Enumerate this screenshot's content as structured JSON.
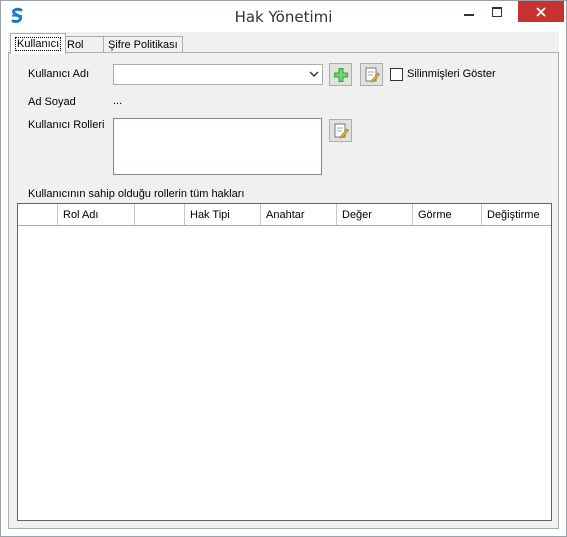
{
  "window": {
    "title": "Hak Yönetimi"
  },
  "tabs": [
    {
      "label": "Kullanıcı",
      "active": true
    },
    {
      "label": "Rol",
      "active": false
    },
    {
      "label": "Şifre Politikası",
      "active": false
    }
  ],
  "user_tab": {
    "username_label": "Kullanıcı Adı",
    "username_value": "",
    "show_deleted_label": "Silinmişleri Göster",
    "show_deleted_checked": false,
    "fullname_label": "Ad Soyad",
    "fullname_value": "...",
    "roles_label": "Kullanıcı Rolleri",
    "permissions_title": "Kullanıcının sahip olduğu rollerin tüm hakları",
    "grid_columns": [
      "",
      "Rol Adı",
      "",
      "Hak Tipi",
      "Anahtar",
      "Değer",
      "Görme",
      "Değiştirme"
    ]
  },
  "icons": {
    "app": "app-logo-icon",
    "add": "green-plus-icon",
    "edit": "edit-document-icon"
  },
  "colors": {
    "close_button": "#c7312f",
    "add_icon": "#2fa52f",
    "app_icon": "#1b7bc6"
  }
}
